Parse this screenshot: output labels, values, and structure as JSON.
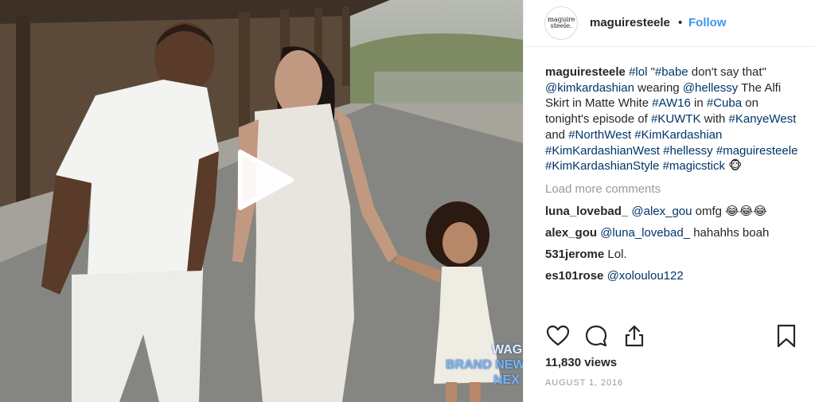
{
  "media": {
    "overlay_line1": "WAG",
    "overlay_line2": "BRAND NEW",
    "overlay_line3": "NEX"
  },
  "header": {
    "avatar_text_1": "maguire",
    "avatar_text_2": "steele.",
    "username": "maguiresteele",
    "separator": "•",
    "follow_label": "Follow"
  },
  "caption": {
    "username": "maguiresteele",
    "parts": [
      {
        "t": "tag",
        "v": "#lol"
      },
      {
        "t": "text",
        "v": " \""
      },
      {
        "t": "tag",
        "v": "#babe"
      },
      {
        "t": "text",
        "v": " don't say that\" "
      },
      {
        "t": "tag",
        "v": "@kimkardashian"
      },
      {
        "t": "text",
        "v": " wearing "
      },
      {
        "t": "tag",
        "v": "@hellessy"
      },
      {
        "t": "text",
        "v": " The Alfi Skirt in Matte White "
      },
      {
        "t": "tag",
        "v": "#AW16"
      },
      {
        "t": "text",
        "v": " in "
      },
      {
        "t": "tag",
        "v": "#Cuba"
      },
      {
        "t": "text",
        "v": " on tonight's episode of "
      },
      {
        "t": "tag",
        "v": "#KUWTK"
      },
      {
        "t": "text",
        "v": " with "
      },
      {
        "t": "tag",
        "v": "#KanyeWest"
      },
      {
        "t": "text",
        "v": " and "
      },
      {
        "t": "tag",
        "v": "#NorthWest"
      },
      {
        "t": "text",
        "v": " "
      },
      {
        "t": "tag",
        "v": "#KimKardashian"
      },
      {
        "t": "text",
        "v": " "
      },
      {
        "t": "tag",
        "v": "#KimKardashianWest"
      },
      {
        "t": "text",
        "v": " "
      },
      {
        "t": "tag",
        "v": "#hellessy"
      },
      {
        "t": "text",
        "v": " "
      },
      {
        "t": "tag",
        "v": "#maguiresteele"
      },
      {
        "t": "text",
        "v": " "
      },
      {
        "t": "tag",
        "v": "#KimKardashianStyle"
      },
      {
        "t": "text",
        "v": " "
      },
      {
        "t": "tag",
        "v": "#magicstick"
      },
      {
        "t": "text",
        "v": " 🐵"
      }
    ]
  },
  "load_more_label": "Load more comments",
  "comments": [
    {
      "user": "luna_lovebad_",
      "mention": "@alex_gou",
      "text": " omfg 😂😂😂"
    },
    {
      "user": "alex_gou",
      "mention": "@luna_lovebad_",
      "text": " hahahhs boah"
    },
    {
      "user": "531jerome",
      "mention": "",
      "text": "Lol."
    },
    {
      "user": "es101rose",
      "mention": "@xoloulou122",
      "text": ""
    }
  ],
  "actions": {
    "like_icon": "heart-icon",
    "comment_icon": "comment-icon",
    "share_icon": "share-icon",
    "save_icon": "bookmark-icon"
  },
  "likes": "11,830 views",
  "date": "AUGUST 1, 2016",
  "colors": {
    "link": "#003569",
    "follow": "#3897f0",
    "text": "#262626",
    "muted": "#999999"
  }
}
